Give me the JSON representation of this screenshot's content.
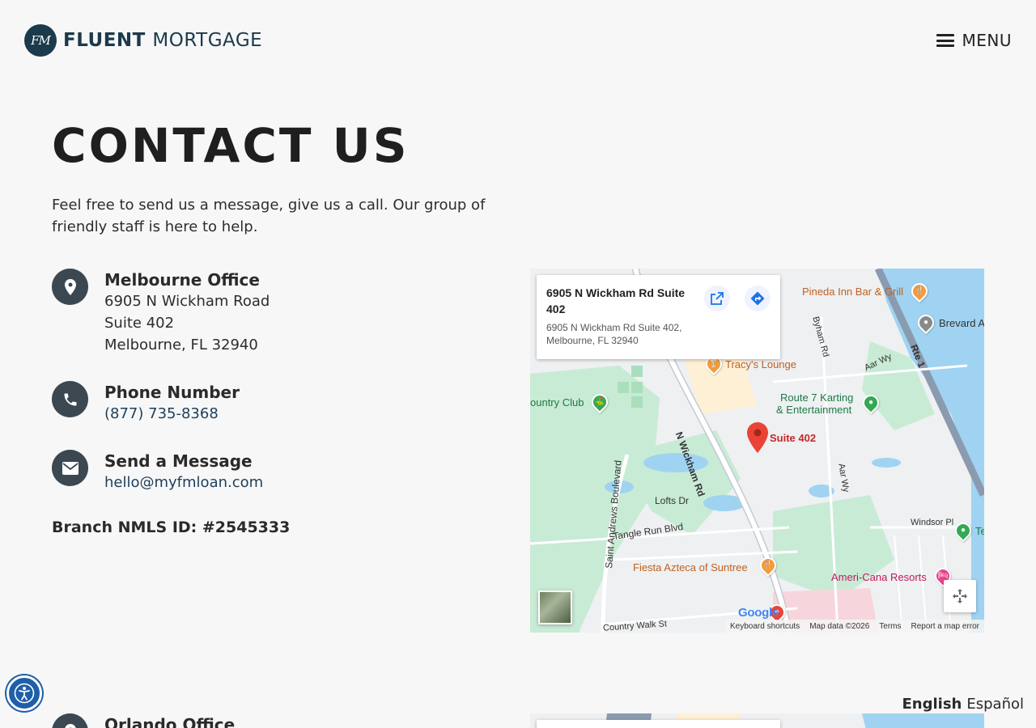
{
  "header": {
    "logo_monogram": "FM",
    "logo_brand_bold": "FLUENT",
    "logo_brand_light": "MORTGAGE",
    "menu_label": "MENU"
  },
  "hero": {
    "title": "CONTACT US",
    "intro": "Feel free to send us a message, give us a call. Our group of friendly staff is here to help."
  },
  "contacts": {
    "office": {
      "title": "Melbourne Office",
      "line1": "6905 N Wickham Road",
      "line2": "Suite 402",
      "line3": "Melbourne, FL 32940",
      "icon": "map-pin-icon"
    },
    "phone": {
      "title": "Phone Number",
      "value": "(877) 735-8368",
      "icon": "phone-icon"
    },
    "message": {
      "title": "Send a Message",
      "value": "hello@myfmloan.com",
      "icon": "envelope-icon"
    },
    "nmls": "Branch NMLS ID: #2545333"
  },
  "map": {
    "infowindow_title": "6905 N Wickham Rd Suite 402",
    "infowindow_address": "6905 N Wickham Rd Suite 402, Melbourne, FL 32940",
    "labels": {
      "pineda": "Pineda Inn Bar & Grill",
      "brevard": "Brevard Appraisal",
      "tracys": "Tracy's Lounge",
      "route7a": "Route 7 Karting",
      "route7b": "& Entertainment",
      "country_club": "ountry Club",
      "suite": "Suite 402",
      "fiesta": "Fiesta Azteca of Suntree",
      "americana": "Ameri-Cana Resorts",
      "te": "Te",
      "rd1": "N Wickham Rd",
      "rd2": "Saint Andrews Boulevard",
      "rd3": "Lofts Dr",
      "rd4": "Tangle Run Blvd",
      "rd5": "Byham Rd",
      "rd6": "Aar Wy",
      "rd7": "Rte 1",
      "rd8": "Windsor Pl",
      "rd9": "Country Walk St",
      "rd10": "Aar Wy"
    },
    "google": "Google",
    "attribution": {
      "shortcuts": "Keyboard shortcuts",
      "data": "Map data ©2026",
      "terms": "Terms",
      "report": "Report a map error"
    }
  },
  "orlando": {
    "title": "Orlando Office"
  },
  "language": {
    "active": "English",
    "other": "Español"
  },
  "colors": {
    "brand_navy": "#1b3a4c",
    "icon_bg": "#3b4852",
    "water": "#9fd3f1",
    "park": "#c8ebd5",
    "pin_red": "#ea4335"
  }
}
